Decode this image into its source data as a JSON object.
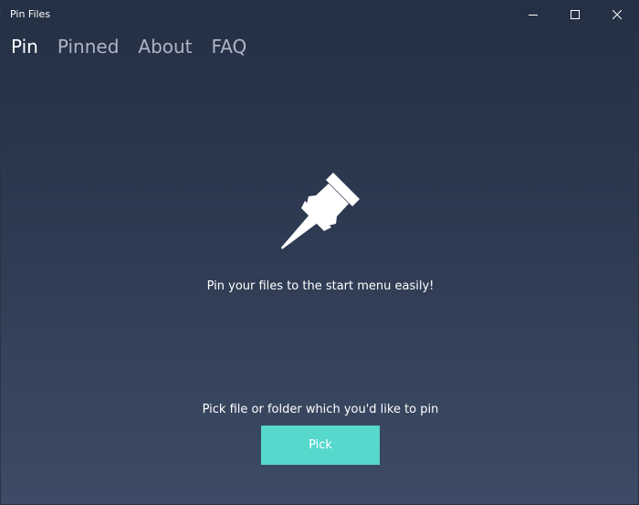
{
  "window": {
    "title": "Pin Files",
    "controls": [
      "minimize-icon",
      "maximize-icon",
      "close-icon"
    ]
  },
  "nav": {
    "tabs": [
      {
        "label": "Pin",
        "active": true
      },
      {
        "label": "Pinned",
        "active": false
      },
      {
        "label": "About",
        "active": false
      },
      {
        "label": "FAQ",
        "active": false
      }
    ]
  },
  "main": {
    "icon": "pushpin-icon",
    "tagline": "Pin your files to the start menu easily!",
    "prompt": "Pick file or folder which you'd like to pin",
    "pick_label": "Pick"
  },
  "colors": {
    "accent": "#57d8cd",
    "background_top": "#243044",
    "background_bottom": "#3d4b66",
    "inactive_tab": "#aeb6c4"
  }
}
